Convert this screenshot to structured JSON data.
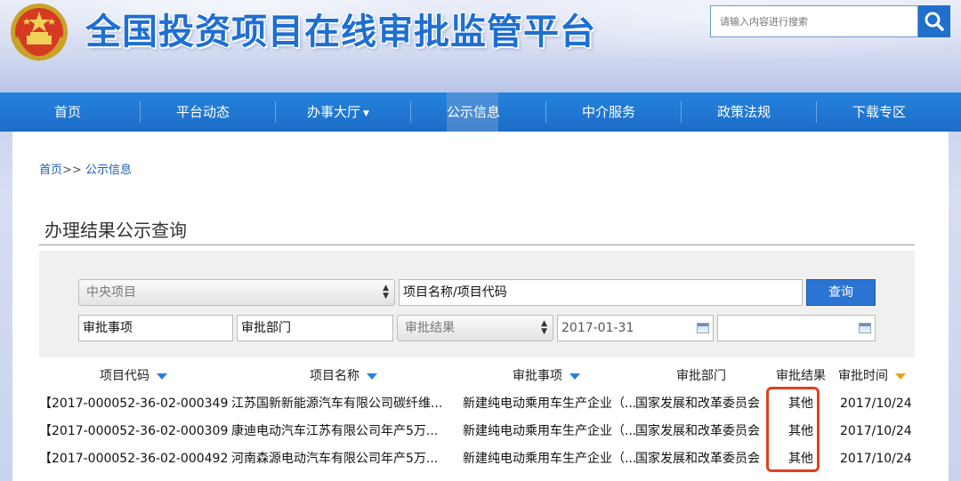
{
  "header": {
    "title": "全国投资项目在线审批监管平台",
    "search_placeholder": "请输入内容进行搜索",
    "search_icon": "search-icon",
    "emblem_icon": "national-emblem-icon"
  },
  "nav": {
    "items": [
      {
        "label": "首页"
      },
      {
        "label": "平台动态"
      },
      {
        "label": "办事大厅",
        "caret": "▼"
      },
      {
        "label": "公示信息"
      },
      {
        "label": "中介服务"
      },
      {
        "label": "政策法规"
      },
      {
        "label": "下载专区"
      }
    ]
  },
  "breadcrumb": {
    "home": "首页",
    "separator": ">>",
    "current": "公示信息"
  },
  "page_heading": "办理结果公示查询",
  "filters": {
    "project_scope": "中央项目",
    "project_name_code": "项目名称/项目代码",
    "query_button": "查询",
    "approval_item": "审批事项",
    "approval_dept": "审批部门",
    "approval_result": "审批结果",
    "date_start": "2017-01-31",
    "date_end": ""
  },
  "table": {
    "columns": [
      "项目代码",
      "项目名称",
      "审批事项",
      "审批部门",
      "审批结果",
      "审批时间"
    ],
    "rows": [
      {
        "code": "【2017-000052-36-02-000349】",
        "name": "江苏国新新能源汽车有限公司碳纤维...",
        "item": "新建纯电动乘用车生产企业（...",
        "dept": "国家发展和改革委员会",
        "result": "其他",
        "time": "2017/10/24"
      },
      {
        "code": "【2017-000052-36-02-000309】",
        "name": "康迪电动汽车江苏有限公司年产5万...",
        "item": "新建纯电动乘用车生产企业（...",
        "dept": "国家发展和改革委员会",
        "result": "其他",
        "time": "2017/10/24"
      },
      {
        "code": "【2017-000052-36-02-000492】",
        "name": "河南森源电动汽车有限公司年产5万...",
        "item": "新建纯电动乘用车生产企业（...",
        "dept": "国家发展和改革委员会",
        "result": "其他",
        "time": "2017/10/24"
      }
    ]
  },
  "colors": {
    "brand_blue": "#1f6fcb",
    "highlight_red": "#e0411f"
  }
}
